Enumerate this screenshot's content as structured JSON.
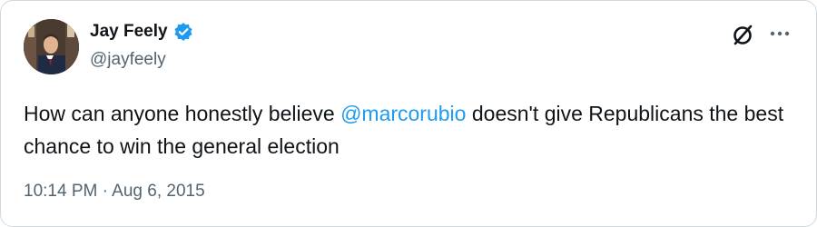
{
  "author": {
    "name": "Jay Feely",
    "handle": "@jayfeely",
    "verified_color": "#1d9bf0"
  },
  "tweet": {
    "text_before": "How can anyone honestly believe ",
    "mention": "@marcorubio",
    "text_after": " doesn't give Republicans the best chance to win the general election"
  },
  "meta": {
    "time": "10:14 PM",
    "separator": " · ",
    "date": "Aug 6, 2015"
  },
  "icons": {
    "logo": "strikethrough-circle-icon",
    "more": "more-horizontal-icon",
    "verified": "verified-badge-icon"
  }
}
